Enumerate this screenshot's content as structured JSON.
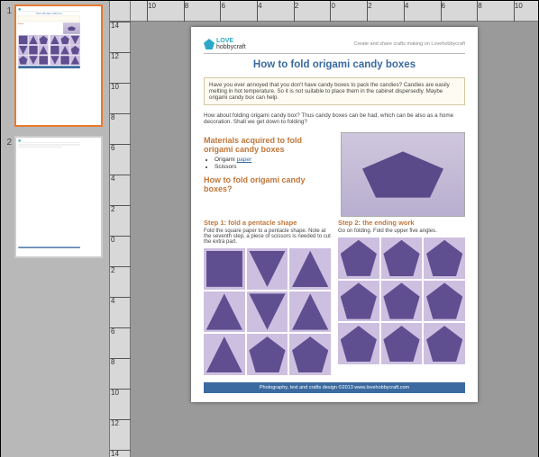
{
  "thumbs": {
    "pages": [
      "1",
      "2"
    ],
    "selected": 0
  },
  "ruler": {
    "h": [
      "10",
      "8",
      "6",
      "4",
      "2",
      "0",
      "2",
      "4",
      "6",
      "8",
      "10"
    ],
    "v": [
      "14",
      "12",
      "10",
      "8",
      "6",
      "4",
      "2",
      "0",
      "2",
      "4",
      "6",
      "8",
      "10",
      "12",
      "14"
    ]
  },
  "doc": {
    "logo": {
      "top": "LOVE",
      "bottom": "hobbycraft"
    },
    "tagline": "Create and share crafts making on Lovehobbycraft",
    "title": "How to fold origami candy boxes",
    "intro": "Have you ever annoyed that you don't have candy boxes to pack the candies? Candies are easily melting in hot temperature. So it is not suitable to place them in the cabinet dispersedly. Maybe origami candy box can help.",
    "lead": "How about folding origami candy box? Thus candy boxes can be had, which can be also as a home decoration. Shall we get down to folding?",
    "sec_materials": "Materials acquired to fold origami candy boxes",
    "materials": {
      "item1a": "Origami ",
      "item1b": "paper",
      "item2": "Scissors"
    },
    "sec_how": "How to fold origami candy boxes?",
    "step1": {
      "title": "Step 1: fold a pentacle shape",
      "desc": "Fold the square paper to a pentacle shape. Note at the seventh step, a piece of scissors is needed to cut the extra part."
    },
    "step2": {
      "title": "Step 2: the ending work",
      "desc": "Go on folding. Fold the upper five angles."
    },
    "footer": "Photography, text and crafts design ©2013 www.lovehobbycraft.com"
  }
}
